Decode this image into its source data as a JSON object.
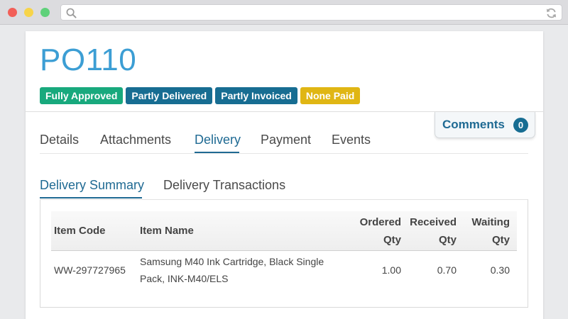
{
  "browser": {
    "search_icon": "search-icon",
    "reload_icon": "reload-icon"
  },
  "po": {
    "title": "PO110",
    "badges": [
      {
        "label": "Fully Approved",
        "color": "#18a97d"
      },
      {
        "label": "Partly Delivered",
        "color": "#176d92"
      },
      {
        "label": "Partly Invoiced",
        "color": "#176d92"
      },
      {
        "label": "None Paid",
        "color": "#e0b614"
      }
    ]
  },
  "comments": {
    "label": "Comments",
    "count": "0"
  },
  "tabs": [
    {
      "label": "Details",
      "active": false
    },
    {
      "label": "Attachments",
      "active": false
    },
    {
      "label": "Delivery",
      "active": true
    },
    {
      "label": "Payment",
      "active": false
    },
    {
      "label": "Events",
      "active": false
    }
  ],
  "subtabs": [
    {
      "label": "Delivery Summary",
      "active": true
    },
    {
      "label": "Delivery Transactions",
      "active": false
    }
  ],
  "table": {
    "headers": {
      "item_code": "Item Code",
      "item_name": "Item Name",
      "ordered_line1": "Ordered",
      "ordered_line2": "Qty",
      "received_line1": "Received",
      "received_line2": "Qty",
      "waiting_line1": "Waiting",
      "waiting_line2": "Qty"
    },
    "rows": [
      {
        "item_code": "WW-297727965",
        "item_name_line1": "Samsung M40 Ink Cartridge, Black Single",
        "item_name_line2": "Pack, INK-M40/ELS",
        "ordered": "1.00",
        "received": "0.70",
        "waiting": "0.30"
      }
    ]
  }
}
